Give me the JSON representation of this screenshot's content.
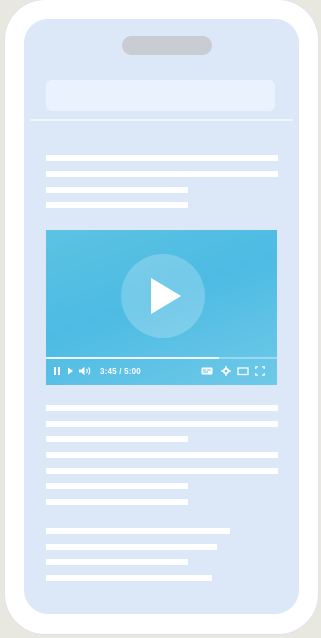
{
  "video": {
    "time": "3:45 / 5:00",
    "progress": 0.75
  },
  "icons": {
    "pause": "pause-icon",
    "next": "next-icon",
    "volume": "volume-icon",
    "captions": "captions-icon",
    "settings": "settings-icon",
    "theater": "theater-icon",
    "fullscreen": "fullscreen-icon",
    "play": "play-icon"
  },
  "colors": {
    "screen_bg": "#dce8f8",
    "video_bg": "#4dbbe3"
  }
}
